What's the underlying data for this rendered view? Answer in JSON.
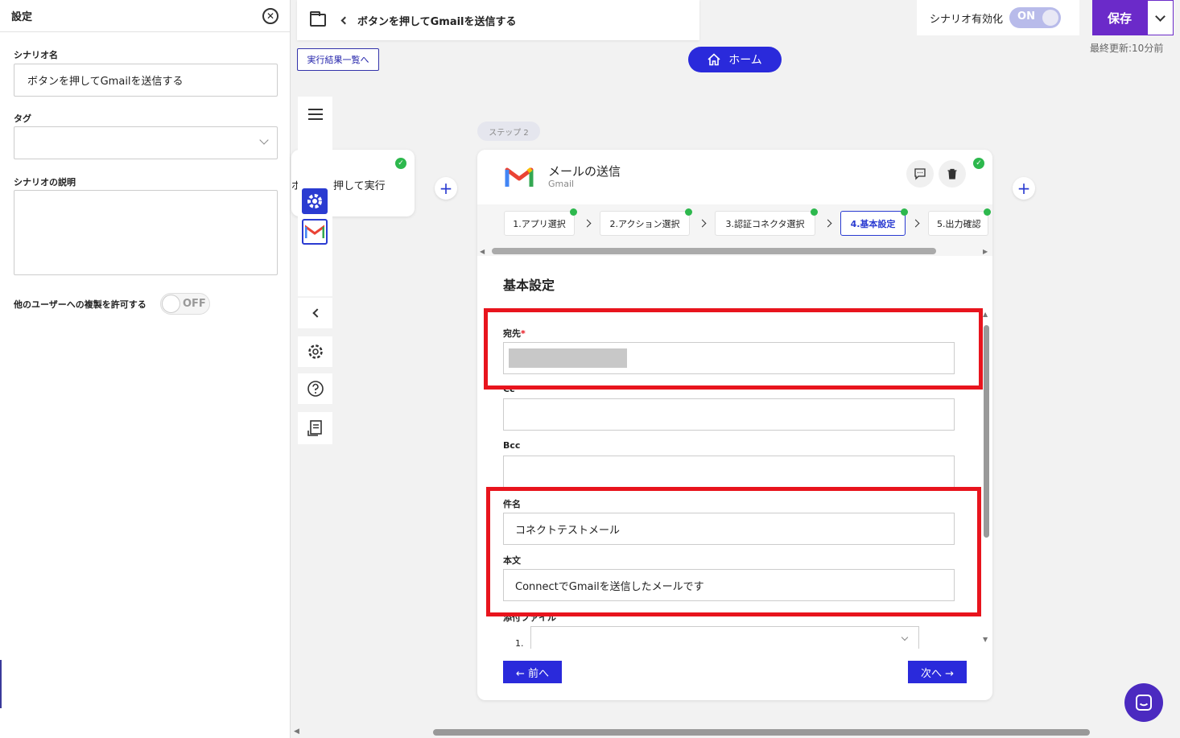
{
  "settings_panel": {
    "title": "設定",
    "scenario_name_label": "シナリオ名",
    "scenario_name_value": "ボタンを押してGmailを送信する",
    "tag_label": "タグ",
    "description_label": "シナリオの説明",
    "allow_copy_label": "他のユーザーへの複製を許可する",
    "allow_copy_toggle": "OFF"
  },
  "header": {
    "breadcrumb": "ボタンを押してGmailを送信する",
    "results_link": "実行結果一覧へ",
    "home_button": "ホーム",
    "enable_label": "シナリオ有効化",
    "enable_toggle": "ON",
    "save_button": "保存",
    "last_updated": "最終更新:10分前"
  },
  "step1": {
    "text": "ボタンを押して実行"
  },
  "step_label": "ステップ 2",
  "card": {
    "title": "メールの送信",
    "subtitle": "Gmail",
    "tabs": [
      {
        "label": "1.アプリ選択"
      },
      {
        "label": "2.アクション選択"
      },
      {
        "label": "3.認証コネクタ選択"
      },
      {
        "label": "4.基本設定"
      },
      {
        "label": "5.出力確認"
      }
    ],
    "section_title": "基本設定",
    "to_label": "宛先",
    "required_mark": "*",
    "cc_label": "Cc",
    "bcc_label": "Bcc",
    "subject_label": "件名",
    "subject_value": "コネクトテストメール",
    "body_label": "本文",
    "body_value": "ConnectでGmailを送信したメールです",
    "attachment_label": "添付ファイル",
    "attachment_index": "1.",
    "prev_button": "← 前へ",
    "next_button": "次へ →"
  },
  "colors": {
    "accent": "#2a2adb",
    "save": "#6b2ac9",
    "highlight": "#e8141d",
    "success": "#2db84d"
  }
}
